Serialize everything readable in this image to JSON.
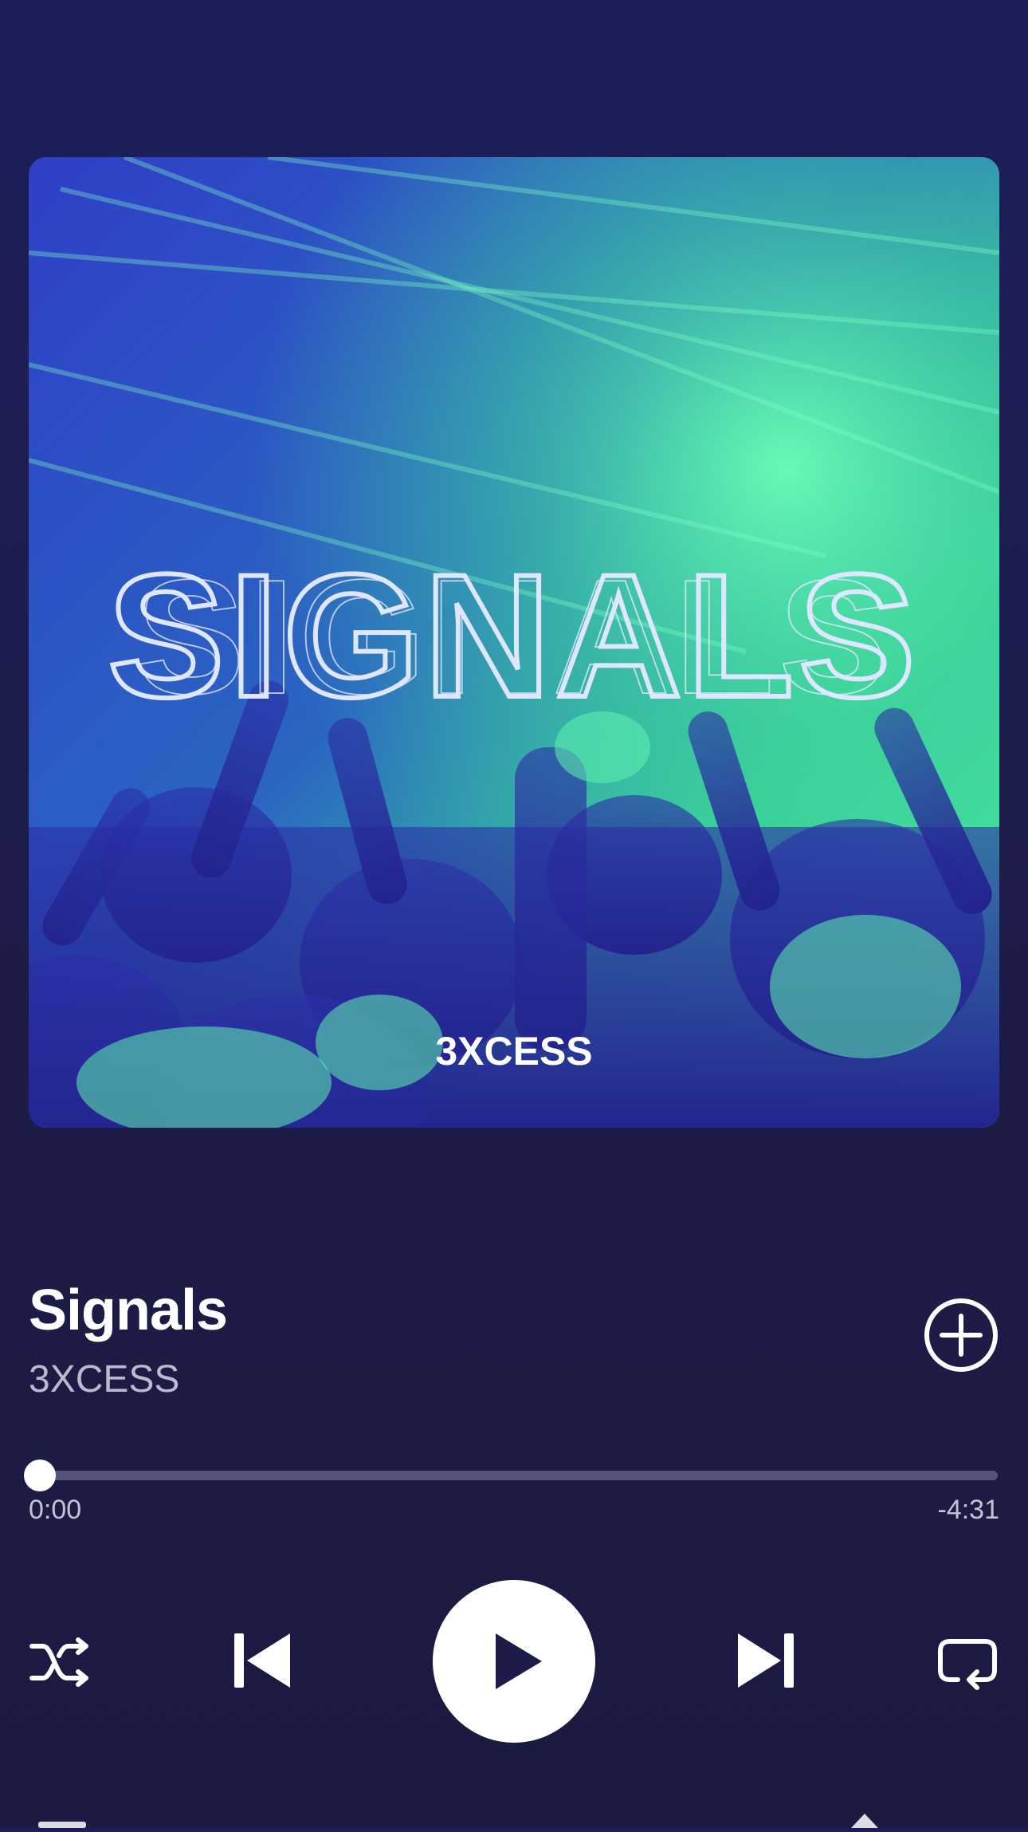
{
  "album_art": {
    "title_text": "SIGNALS",
    "artist_text": "3XCESS"
  },
  "track": {
    "title": "Signals",
    "artist": "3XCESS"
  },
  "progress": {
    "elapsed": "0:00",
    "remaining": "-4:31",
    "fraction": 0
  },
  "controls": {
    "shuffle_icon": "shuffle-icon",
    "previous_icon": "skip-previous-icon",
    "play_icon": "play-icon",
    "next_icon": "skip-next-icon",
    "repeat_icon": "repeat-icon",
    "add_icon": "add-circle-icon"
  },
  "colors": {
    "background": "#1d1c48",
    "accent": "#ffffff",
    "track_bg": "#55557a",
    "secondary_text": "#b9b9cf"
  }
}
